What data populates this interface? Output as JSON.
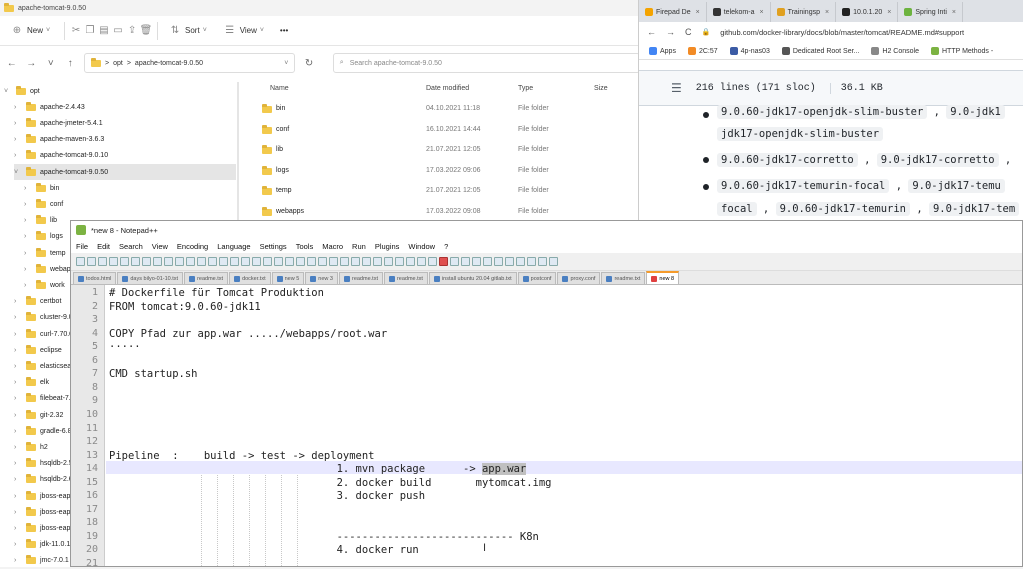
{
  "explorer": {
    "title": "apache-tomcat-9.0.50",
    "toolbar": {
      "new": "New",
      "sort": "Sort",
      "view": "View",
      "more": "•••"
    },
    "address": [
      "opt",
      "apache-tomcat-9.0.50"
    ],
    "address_sep": ">",
    "search_placeholder": "Search apache-tomcat-9.0.50",
    "tree": [
      {
        "label": "opt",
        "expanded": true
      },
      {
        "label": "apache-2.4.43"
      },
      {
        "label": "apache-jmeter-5.4.1"
      },
      {
        "label": "apache-maven-3.6.3"
      },
      {
        "label": "apache-tomcat-9.0.10"
      },
      {
        "label": "apache-tomcat-9.0.50",
        "expanded": true
      },
      {
        "label": "bin"
      },
      {
        "label": "conf"
      },
      {
        "label": "lib"
      },
      {
        "label": "logs"
      },
      {
        "label": "temp"
      },
      {
        "label": "webapps"
      },
      {
        "label": "work"
      },
      {
        "label": "certbot"
      },
      {
        "label": "cluster-9.0."
      },
      {
        "label": "curl-7.70.0"
      },
      {
        "label": "eclipse"
      },
      {
        "label": "elasticsear"
      },
      {
        "label": "elk"
      },
      {
        "label": "filebeat-7."
      },
      {
        "label": "git-2.32"
      },
      {
        "label": "gradle-6.8."
      },
      {
        "label": "h2"
      },
      {
        "label": "hsqldb-2.5."
      },
      {
        "label": "hsqldb-2.6."
      },
      {
        "label": "jboss-eap-"
      },
      {
        "label": "jboss-eap-"
      },
      {
        "label": "jboss-eap-"
      },
      {
        "label": "jdk-11.0.1"
      },
      {
        "label": "jmc-7.0.1"
      }
    ],
    "columns": {
      "name": "Name",
      "date": "Date modified",
      "type": "Type",
      "size": "Size"
    },
    "files": [
      {
        "name": "bin",
        "date": "04.10.2021 11:18",
        "type": "File folder"
      },
      {
        "name": "conf",
        "date": "16.10.2021 14:44",
        "type": "File folder"
      },
      {
        "name": "lib",
        "date": "21.07.2021 12:05",
        "type": "File folder"
      },
      {
        "name": "logs",
        "date": "17.03.2022 09:06",
        "type": "File folder"
      },
      {
        "name": "temp",
        "date": "21.07.2021 12:05",
        "type": "File folder"
      },
      {
        "name": "webapps",
        "date": "17.03.2022 09:08",
        "type": "File folder"
      }
    ]
  },
  "browser": {
    "tabs": [
      {
        "label": "Firepad De",
        "color": "#f4a300"
      },
      {
        "label": "telekom-a",
        "color": "#333333"
      },
      {
        "label": "Trainingsp",
        "color": "#e0a020"
      },
      {
        "label": "10.0.1.20",
        "color": "#222222"
      },
      {
        "label": "Spring Inti",
        "color": "#6db33f"
      }
    ],
    "nav": {
      "back": "←",
      "forward": "→",
      "reload": "C",
      "lock": "🔒"
    },
    "url": "github.com/docker-library/docs/blob/master/tomcat/README.md#support",
    "bookmarks": [
      "Apps",
      "2C:57",
      "4p-nas03",
      "Dedicated Root Ser...",
      "H2 Console",
      "HTTP Methods -"
    ],
    "file_info": {
      "lines": "216 lines (171 sloc)",
      "size": "36.1 KB"
    },
    "tags_line1": [
      "9.0.60-jdk17-openjdk-slim-buster",
      "9.0-jdk1"
    ],
    "tags_line1_cont": "jdk17-openjdk-slim-buster",
    "tags_line2": [
      "9.0.60-jdk17-corretto",
      "9.0-jdk17-corretto"
    ],
    "tags_line3": [
      "9.0.60-jdk17-temurin-focal",
      "9.0-jdk17-temu"
    ],
    "tags_line3_cont": [
      "focal",
      "9.0.60-jdk17-temurin",
      "9.0-jdk17-tem"
    ]
  },
  "notepad": {
    "title": "*new 8 - Notepad++",
    "menu": [
      "File",
      "Edit",
      "Search",
      "View",
      "Encoding",
      "Language",
      "Settings",
      "Tools",
      "Macro",
      "Run",
      "Plugins",
      "Window",
      "?"
    ],
    "tabs": [
      "todos.html",
      "days bilyo-01-10.txt",
      "readme.txt",
      "docker.txt",
      "new 5",
      "new 3",
      "readme.txt",
      "readme.txt",
      "install ubuntu 20.04 gitlab.txt",
      "postconf",
      "proxy.conf",
      "readme.txt",
      "new 8"
    ],
    "active_tab": "new 8",
    "lines": [
      "# Dockerfile für Tomcat Produktion",
      "FROM tomcat:9.0.60-jdk11",
      "",
      "COPY Pfad zur app.war ...../webapps/root.war",
      "·····",
      "",
      "CMD startup.sh",
      "",
      "",
      "",
      "",
      "",
      "Pipeline  :    build -> test -> deployment",
      "                                    1. mvn package      -> ",
      "                                    2. docker build       mytomcat.img",
      "                                    3. docker push",
      "",
      "",
      "                                    ---------------------------- K8n",
      "                                    4. docker run",
      ""
    ],
    "selected_word": "app.war",
    "cursor_glyph": "I"
  }
}
